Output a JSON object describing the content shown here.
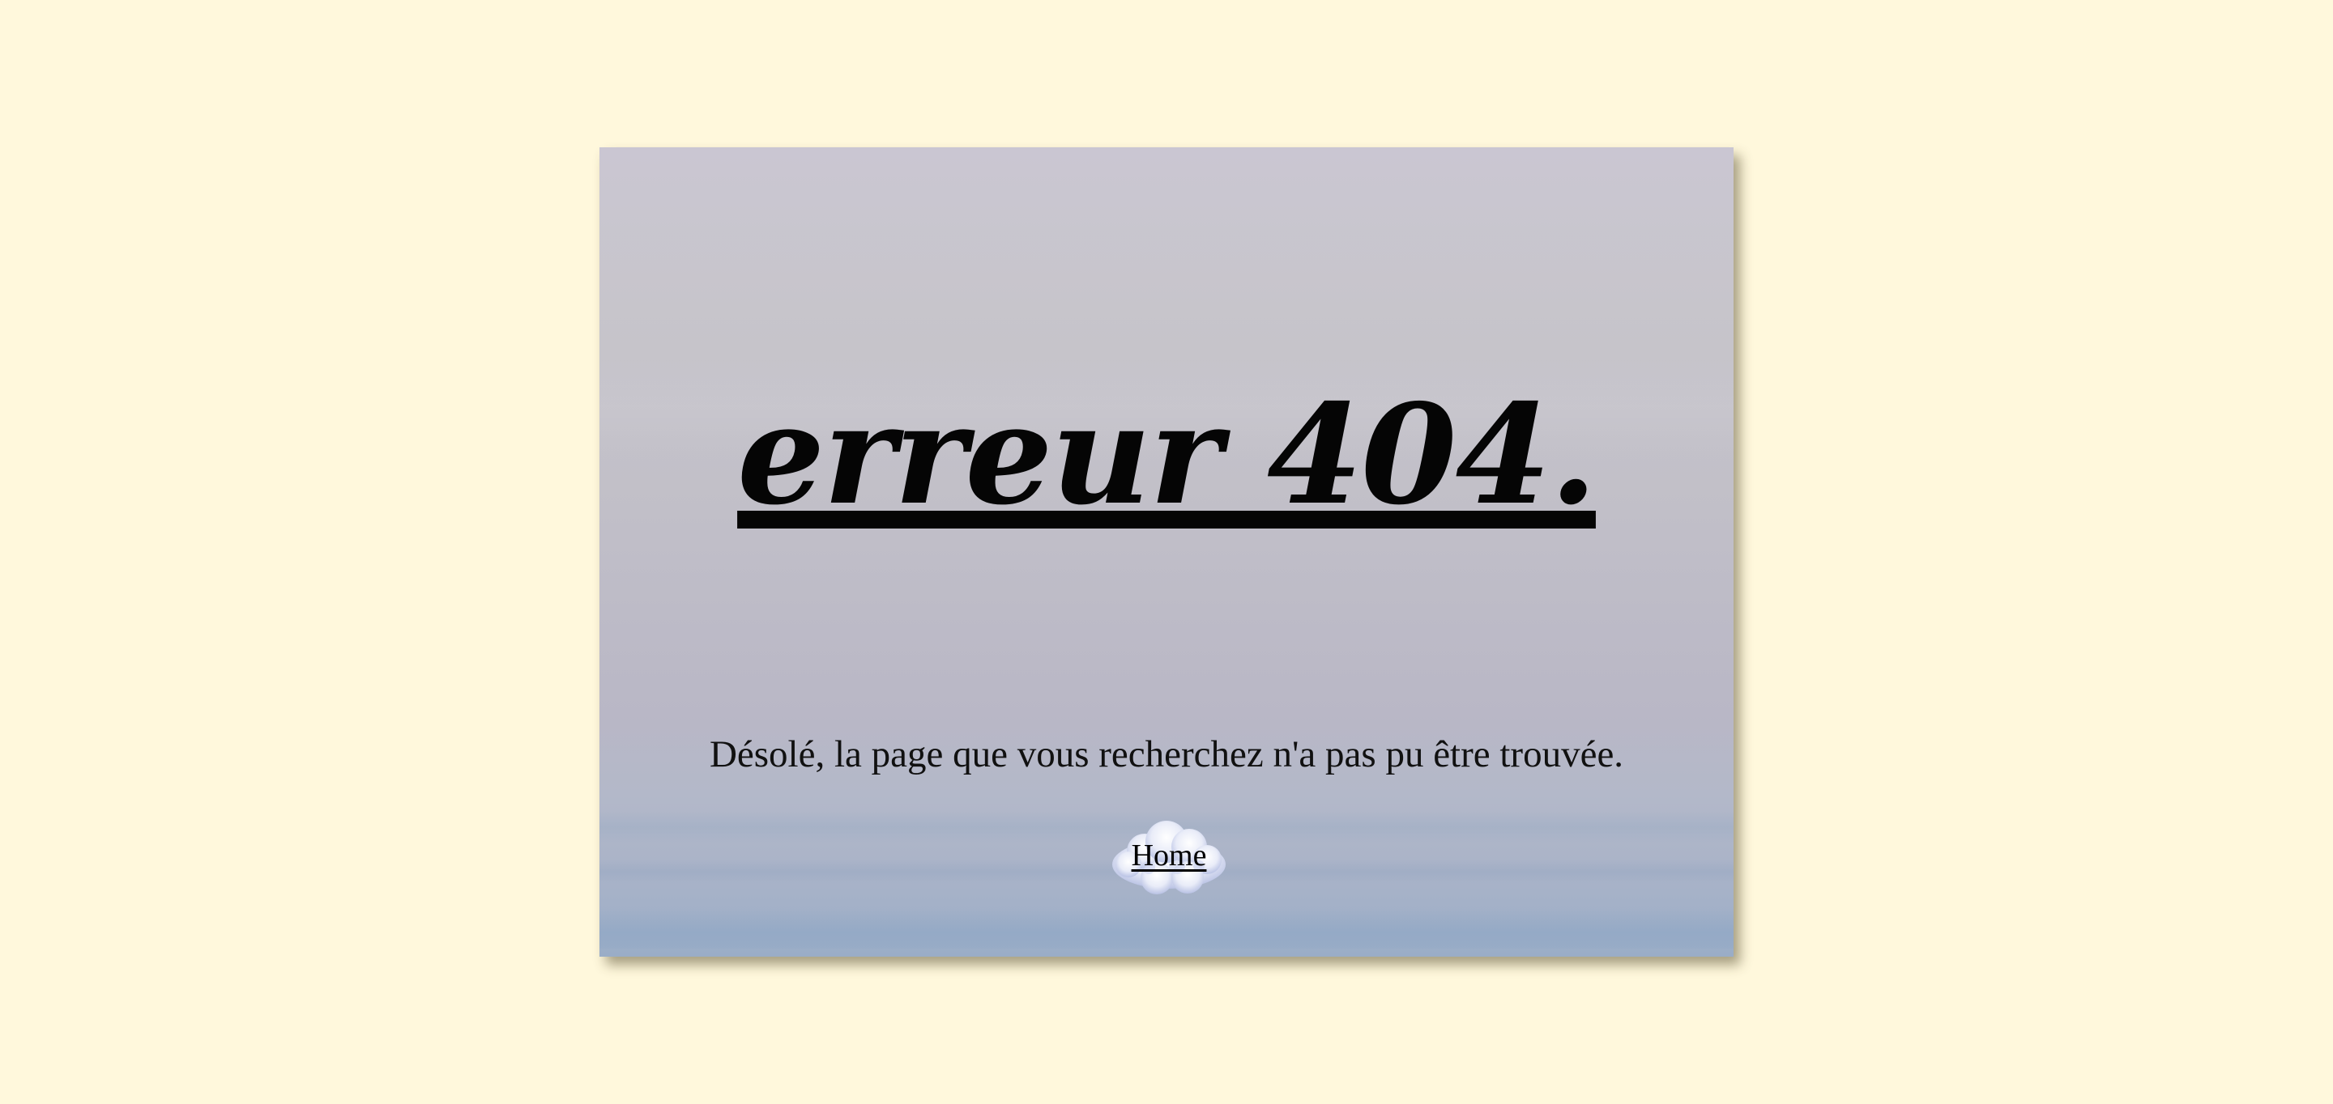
{
  "error_page": {
    "title": "erreur 404.",
    "message": "Désolé, la page que vous recherchez n'a pas pu être trouvée.",
    "home_link": "Home"
  },
  "colors": {
    "page_background": "#fff8dc",
    "text": "#050505",
    "card_top": "#cac6d2",
    "card_bottom": "#9aadc7"
  },
  "icons": {
    "home_background": "cloud-icon"
  }
}
